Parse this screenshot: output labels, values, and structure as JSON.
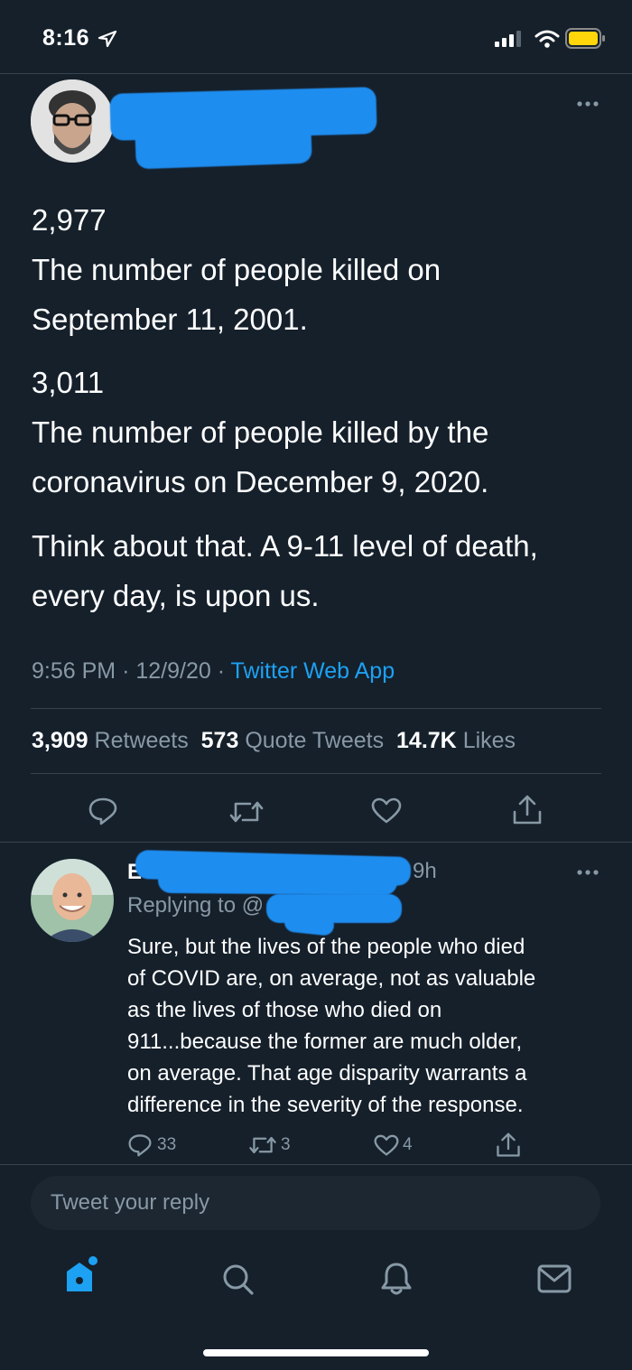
{
  "status_bar": {
    "time": "8:16"
  },
  "tweet": {
    "paragraphs": [
      [
        "2,977",
        "The number of people killed on",
        "September 11, 2001."
      ],
      [
        "3,011",
        "The number of people killed by the",
        "coronavirus on December 9, 2020."
      ],
      [
        "Think about that. A 9-11 level of death,",
        "every day, is upon us."
      ]
    ],
    "time": "9:56 PM",
    "date": "12/9/20",
    "source": "Twitter Web App",
    "retweets_count": "3,909",
    "retweets_label": "Retweets",
    "quotes_count": "573",
    "quotes_label": "Quote Tweets",
    "likes_count": "14.7K",
    "likes_label": "Likes",
    "sep": "·"
  },
  "reply": {
    "initial": "E",
    "age": "9h",
    "replying_to": "Replying to @",
    "lines": [
      "Sure, but the lives of the people who died",
      "of COVID are, on average, not as valuable",
      "as the lives of those who died on",
      "911...because the former are much older,",
      "on average.  That age disparity warrants a",
      "difference in the severity of the response."
    ],
    "reply_count": "33",
    "retweet_count": "3",
    "like_count": "4"
  },
  "composer": {
    "placeholder": "Tweet your reply"
  },
  "colors": {
    "background": "#15202b",
    "accent": "#1da1f2",
    "muted": "#8899a6",
    "redaction": "#1e8df0"
  },
  "icons": [
    "location-arrow-icon",
    "signal-icon",
    "wifi-icon",
    "battery-icon",
    "more-icon",
    "reply-icon",
    "retweet-icon",
    "like-icon",
    "share-icon",
    "home-icon",
    "search-icon",
    "notifications-icon",
    "messages-icon"
  ]
}
